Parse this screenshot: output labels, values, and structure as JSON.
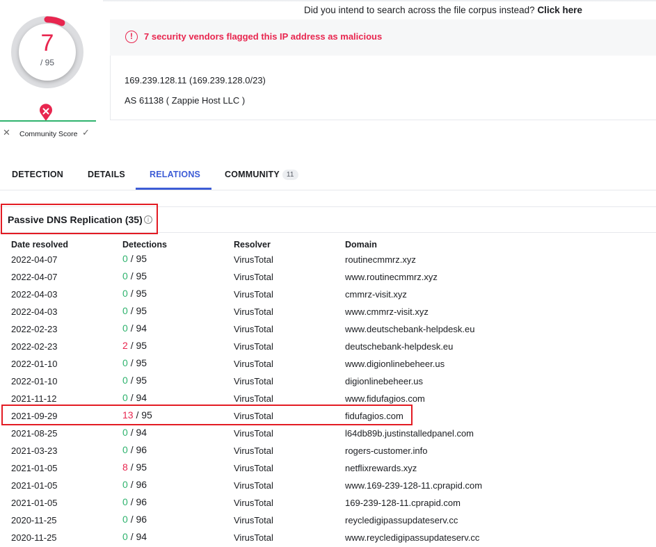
{
  "search_hint": {
    "text": "Did you intend to search across the file corpus instead? ",
    "link": "Click here"
  },
  "score": {
    "detected": "7",
    "total": "/ 95",
    "community_label": "Community Score",
    "fraction": 0.0737
  },
  "summary": {
    "alert": "7 security vendors flagged this IP address as malicious",
    "ip": "169.239.128.11   (169.239.128.0/23)",
    "as": "AS 61138 ( Zappie Host LLC )"
  },
  "tabs": [
    {
      "label": "DETECTION"
    },
    {
      "label": "DETAILS"
    },
    {
      "label": "RELATIONS"
    },
    {
      "label": "COMMUNITY",
      "badge": "11"
    }
  ],
  "section": {
    "title": "Passive DNS Replication (35)"
  },
  "table": {
    "headers": [
      "Date resolved",
      "Detections",
      "Resolver",
      "Domain"
    ],
    "rows": [
      {
        "date": "2022-04-07",
        "det": "0",
        "total": "/ 95",
        "resolver": "VirusTotal",
        "domain": "routinecmmrz.xyz"
      },
      {
        "date": "2022-04-07",
        "det": "0",
        "total": "/ 95",
        "resolver": "VirusTotal",
        "domain": "www.routinecmmrz.xyz"
      },
      {
        "date": "2022-04-03",
        "det": "0",
        "total": "/ 95",
        "resolver": "VirusTotal",
        "domain": "cmmrz-visit.xyz"
      },
      {
        "date": "2022-04-03",
        "det": "0",
        "total": "/ 95",
        "resolver": "VirusTotal",
        "domain": "www.cmmrz-visit.xyz"
      },
      {
        "date": "2022-02-23",
        "det": "0",
        "total": "/ 94",
        "resolver": "VirusTotal",
        "domain": "www.deutschebank-helpdesk.eu"
      },
      {
        "date": "2022-02-23",
        "det": "2",
        "total": "/ 95",
        "resolver": "VirusTotal",
        "domain": "deutschebank-helpdesk.eu"
      },
      {
        "date": "2022-01-10",
        "det": "0",
        "total": "/ 95",
        "resolver": "VirusTotal",
        "domain": "www.digionlinebeheer.us"
      },
      {
        "date": "2022-01-10",
        "det": "0",
        "total": "/ 95",
        "resolver": "VirusTotal",
        "domain": "digionlinebeheer.us"
      },
      {
        "date": "2021-11-12",
        "det": "0",
        "total": "/ 94",
        "resolver": "VirusTotal",
        "domain": "www.fidufagios.com"
      },
      {
        "date": "2021-09-29",
        "det": "13",
        "total": "/ 95",
        "resolver": "VirusTotal",
        "domain": "fidufagios.com"
      },
      {
        "date": "2021-08-25",
        "det": "0",
        "total": "/ 94",
        "resolver": "VirusTotal",
        "domain": "l64db89b.justinstalledpanel.com"
      },
      {
        "date": "2021-03-23",
        "det": "0",
        "total": "/ 96",
        "resolver": "VirusTotal",
        "domain": "rogers-customer.info"
      },
      {
        "date": "2021-01-05",
        "det": "8",
        "total": "/ 95",
        "resolver": "VirusTotal",
        "domain": "netflixrewards.xyz"
      },
      {
        "date": "2021-01-05",
        "det": "0",
        "total": "/ 96",
        "resolver": "VirusTotal",
        "domain": "www.169-239-128-11.cprapid.com"
      },
      {
        "date": "2021-01-05",
        "det": "0",
        "total": "/ 96",
        "resolver": "VirusTotal",
        "domain": "169-239-128-11.cprapid.com"
      },
      {
        "date": "2020-11-25",
        "det": "0",
        "total": "/ 96",
        "resolver": "VirusTotal",
        "domain": "reycledigipassupdateserv.cc"
      },
      {
        "date": "2020-11-25",
        "det": "0",
        "total": "/ 94",
        "resolver": "VirusTotal",
        "domain": "www.reycledigipassupdateserv.cc"
      }
    ]
  },
  "colors": {
    "malicious": "#e8264f",
    "clean": "#2fb36e",
    "accent": "#3d5cd6",
    "highlight_box": "#e31b23"
  },
  "icons": {
    "alert": "alert-circle-icon",
    "info": "info-icon",
    "vote_down": "close-icon",
    "vote_up": "check-icon",
    "community_marker": "map-pin-x-icon"
  }
}
